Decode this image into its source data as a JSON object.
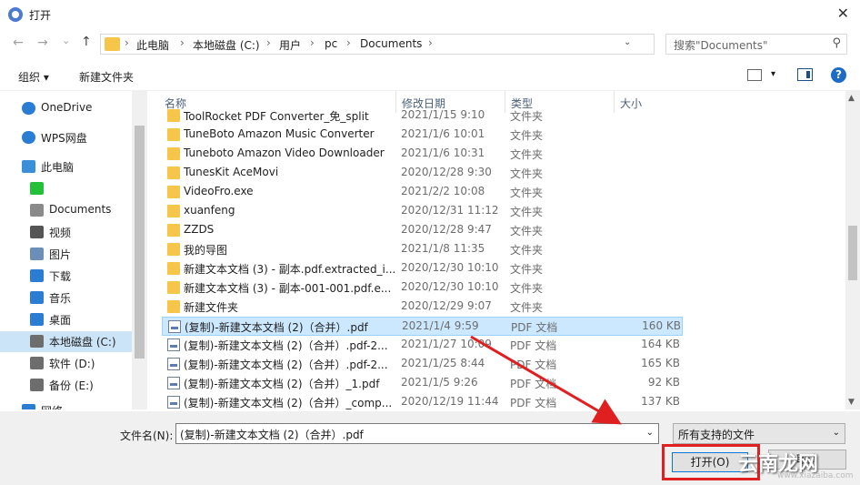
{
  "window": {
    "title": "打开",
    "close_glyph": "✕"
  },
  "nav_buttons": {
    "back": "←",
    "forward": "→",
    "recent": "⌄",
    "up": "↑"
  },
  "address": {
    "crumbs": [
      "此电脑",
      "本地磁盘 (C:)",
      "用户",
      "pc",
      "Documents"
    ],
    "separator": "›",
    "dropdown": "⌄",
    "refresh": "↻"
  },
  "search": {
    "placeholder": "搜索\"Documents\"",
    "icon": "⚲"
  },
  "toolbar": {
    "organize": "组织 ▾",
    "new_folder": "新建文件夹",
    "view_dropdown": "▾",
    "help": "?"
  },
  "sidebar": {
    "items": [
      {
        "label": "OneDrive",
        "icon": "cloud-icon",
        "color": "#2b7cd3"
      },
      {
        "label": "WPS网盘",
        "icon": "wps-cloud-icon",
        "color": "#2b7cd3"
      },
      {
        "label": "此电脑",
        "icon": "computer-icon",
        "color": "#3a8fd9"
      },
      {
        "label": "",
        "icon": "green-app-icon",
        "color": "#25c03a"
      },
      {
        "label": "Documents",
        "icon": "documents-icon",
        "color": "#8a8a8a"
      },
      {
        "label": "视频",
        "icon": "video-icon",
        "color": "#555555"
      },
      {
        "label": "图片",
        "icon": "pictures-icon",
        "color": "#6b8fb8"
      },
      {
        "label": "下载",
        "icon": "download-icon",
        "color": "#2b7cd3"
      },
      {
        "label": "音乐",
        "icon": "music-icon",
        "color": "#2b7cd3"
      },
      {
        "label": "桌面",
        "icon": "desktop-icon",
        "color": "#2b7cd3"
      },
      {
        "label": "本地磁盘 (C:)",
        "icon": "drive-c-icon",
        "color": "#6d6d6d",
        "selected": true
      },
      {
        "label": "软件 (D:)",
        "icon": "drive-icon",
        "color": "#6d6d6d"
      },
      {
        "label": "备份 (E:)",
        "icon": "drive-icon",
        "color": "#6d6d6d"
      },
      {
        "label": "网络",
        "icon": "network-icon",
        "color": "#2b7cd3"
      }
    ]
  },
  "columns": {
    "name": "名称",
    "date": "修改日期",
    "type": "类型",
    "size": "大小",
    "sort_caret": "^"
  },
  "files": [
    {
      "name": "ToolRocket PDF Converter_免_split",
      "date": "2021/1/15 9:10",
      "type": "文件夹",
      "size": "",
      "kind": "folder"
    },
    {
      "name": "TuneBoto Amazon Music Converter",
      "date": "2021/1/6 10:01",
      "type": "文件夹",
      "size": "",
      "kind": "folder"
    },
    {
      "name": "Tuneboto Amazon Video Downloader",
      "date": "2021/1/6 10:31",
      "type": "文件夹",
      "size": "",
      "kind": "folder"
    },
    {
      "name": "TunesKit AceMovi",
      "date": "2020/12/28 9:30",
      "type": "文件夹",
      "size": "",
      "kind": "folder"
    },
    {
      "name": "VideoFro.exe",
      "date": "2021/2/2 10:08",
      "type": "文件夹",
      "size": "",
      "kind": "folder"
    },
    {
      "name": "xuanfeng",
      "date": "2020/12/31 11:12",
      "type": "文件夹",
      "size": "",
      "kind": "folder"
    },
    {
      "name": "ZZDS",
      "date": "2020/12/28 9:47",
      "type": "文件夹",
      "size": "",
      "kind": "folder"
    },
    {
      "name": "我的导图",
      "date": "2021/1/8 11:35",
      "type": "文件夹",
      "size": "",
      "kind": "folder"
    },
    {
      "name": "新建文本文档 (3) - 副本.pdf.extracted_i...",
      "date": "2020/12/30 10:10",
      "type": "文件夹",
      "size": "",
      "kind": "folder"
    },
    {
      "name": "新建文本文档 (3) - 副本-001-001.pdf.e...",
      "date": "2020/12/30 10:10",
      "type": "文件夹",
      "size": "",
      "kind": "folder"
    },
    {
      "name": "新建文件夹",
      "date": "2020/12/29 9:07",
      "type": "文件夹",
      "size": "",
      "kind": "folder"
    },
    {
      "name": "(复制)-新建文本文档 (2)（合并）.pdf",
      "date": "2021/1/4 9:59",
      "type": "PDF 文档",
      "size": "160 KB",
      "kind": "pdf",
      "selected": true
    },
    {
      "name": "(复制)-新建文本文档 (2)（合并）.pdf-2...",
      "date": "2021/1/27 10:09",
      "type": "PDF 文档",
      "size": "164 KB",
      "kind": "pdf"
    },
    {
      "name": "(复制)-新建文本文档 (2)（合并）.pdf-2...",
      "date": "2021/1/25 8:44",
      "type": "PDF 文档",
      "size": "165 KB",
      "kind": "pdf"
    },
    {
      "name": "(复制)-新建文本文档 (2)（合并）_1.pdf",
      "date": "2021/1/5 9:26",
      "type": "PDF 文档",
      "size": "92 KB",
      "kind": "pdf"
    },
    {
      "name": "(复制)-新建文本文档 (2)（合并）_comp...",
      "date": "2020/12/19 11:44",
      "type": "PDF 文档",
      "size": "137 KB",
      "kind": "pdf"
    }
  ],
  "bottom": {
    "filename_label": "文件名(N):",
    "filename_value": "(复制)-新建文本文档 (2)（合并）.pdf",
    "filter_value": "所有支持的文件",
    "open_label": "打开(O)",
    "cancel_label": "取消",
    "dropdown": "⌄"
  },
  "watermark": {
    "main": "云南龙网",
    "sub": "www.xiazaiba.com"
  },
  "colors": {
    "annotation_red": "#e02020",
    "selection": "#cce8ff",
    "accent": "#0078d7"
  }
}
